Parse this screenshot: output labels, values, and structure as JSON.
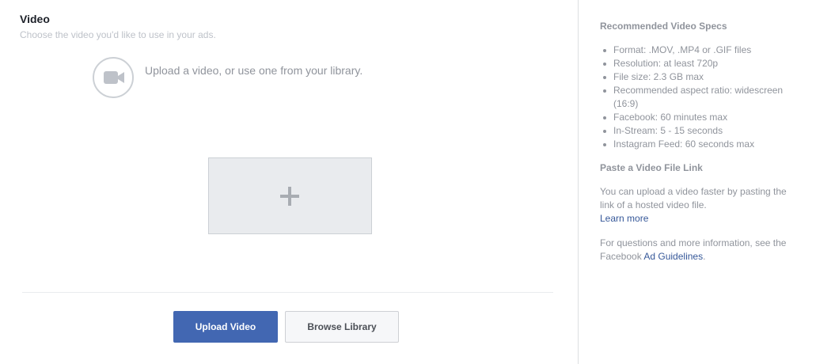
{
  "main": {
    "title": "Video",
    "subtitle": "Choose the video you'd like to use in your ads.",
    "upload_prompt": "Upload a video, or use one from your library.",
    "camera_icon": "video-camera-icon",
    "add_icon": "plus-icon",
    "upload_button": "Upload Video",
    "browse_button": "Browse Library"
  },
  "sidebar": {
    "specs_heading": "Recommended Video Specs",
    "specs": [
      "Format: .MOV, .MP4 or .GIF files",
      "Resolution: at least 720p",
      "File size: 2.3 GB max",
      "Recommended aspect ratio: widescreen (16:9)",
      "Facebook: 60 minutes max",
      "In-Stream: 5 - 15 seconds",
      "Instagram Feed: 60 seconds max"
    ],
    "paste_heading": "Paste a Video File Link",
    "paste_text": "You can upload a video faster by pasting the link of a hosted video file.",
    "learn_more": "Learn more",
    "guidelines_prefix": "For questions and more information, see the Facebook ",
    "guidelines_link": "Ad Guidelines",
    "guidelines_suffix": "."
  },
  "colors": {
    "primary": "#4267b2",
    "link": "#365899",
    "muted_text": "#90949c"
  }
}
